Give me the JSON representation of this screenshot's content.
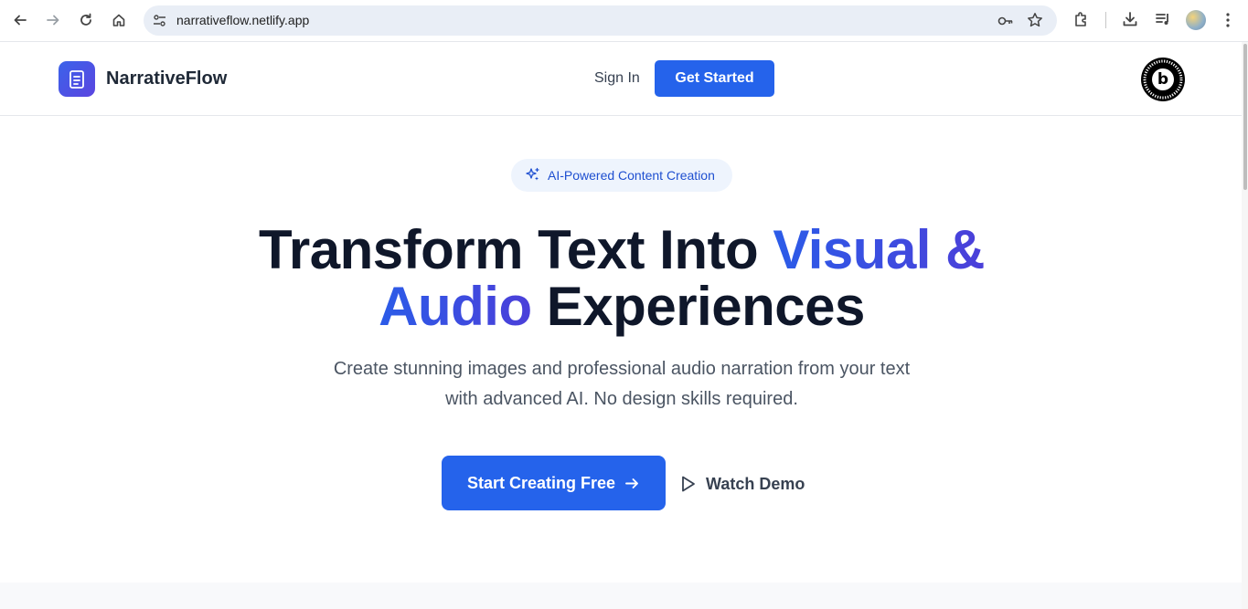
{
  "browser": {
    "url": "narrativeflow.netlify.app",
    "icons": [
      "back-icon",
      "forward-icon",
      "reload-icon",
      "home-icon",
      "site-info-icon",
      "key-icon",
      "star-icon",
      "extensions-icon",
      "download-icon",
      "media-icon",
      "profile-avatar",
      "menu-icon"
    ]
  },
  "header": {
    "brand": "NarrativeFlow",
    "sign_in": "Sign In",
    "get_started": "Get Started",
    "badge_letter": "b"
  },
  "hero": {
    "pill": "AI-Powered Content Creation",
    "title_part1": "Transform Text Into ",
    "title_highlight_1": "Visual &",
    "title_highlight_2": "Audio",
    "title_part2": " Experiences",
    "subtitle_line1": "Create stunning images and professional audio narration from your text",
    "subtitle_line2": "with advanced AI. No design skills required.",
    "cta_primary": "Start Creating Free",
    "cta_secondary": "Watch Demo"
  },
  "colors": {
    "primary": "#2563eb",
    "gradient_start": "#2b5ce8",
    "gradient_end": "#4b3fd9",
    "heading": "#0f172a",
    "body_text": "#4b5563"
  }
}
